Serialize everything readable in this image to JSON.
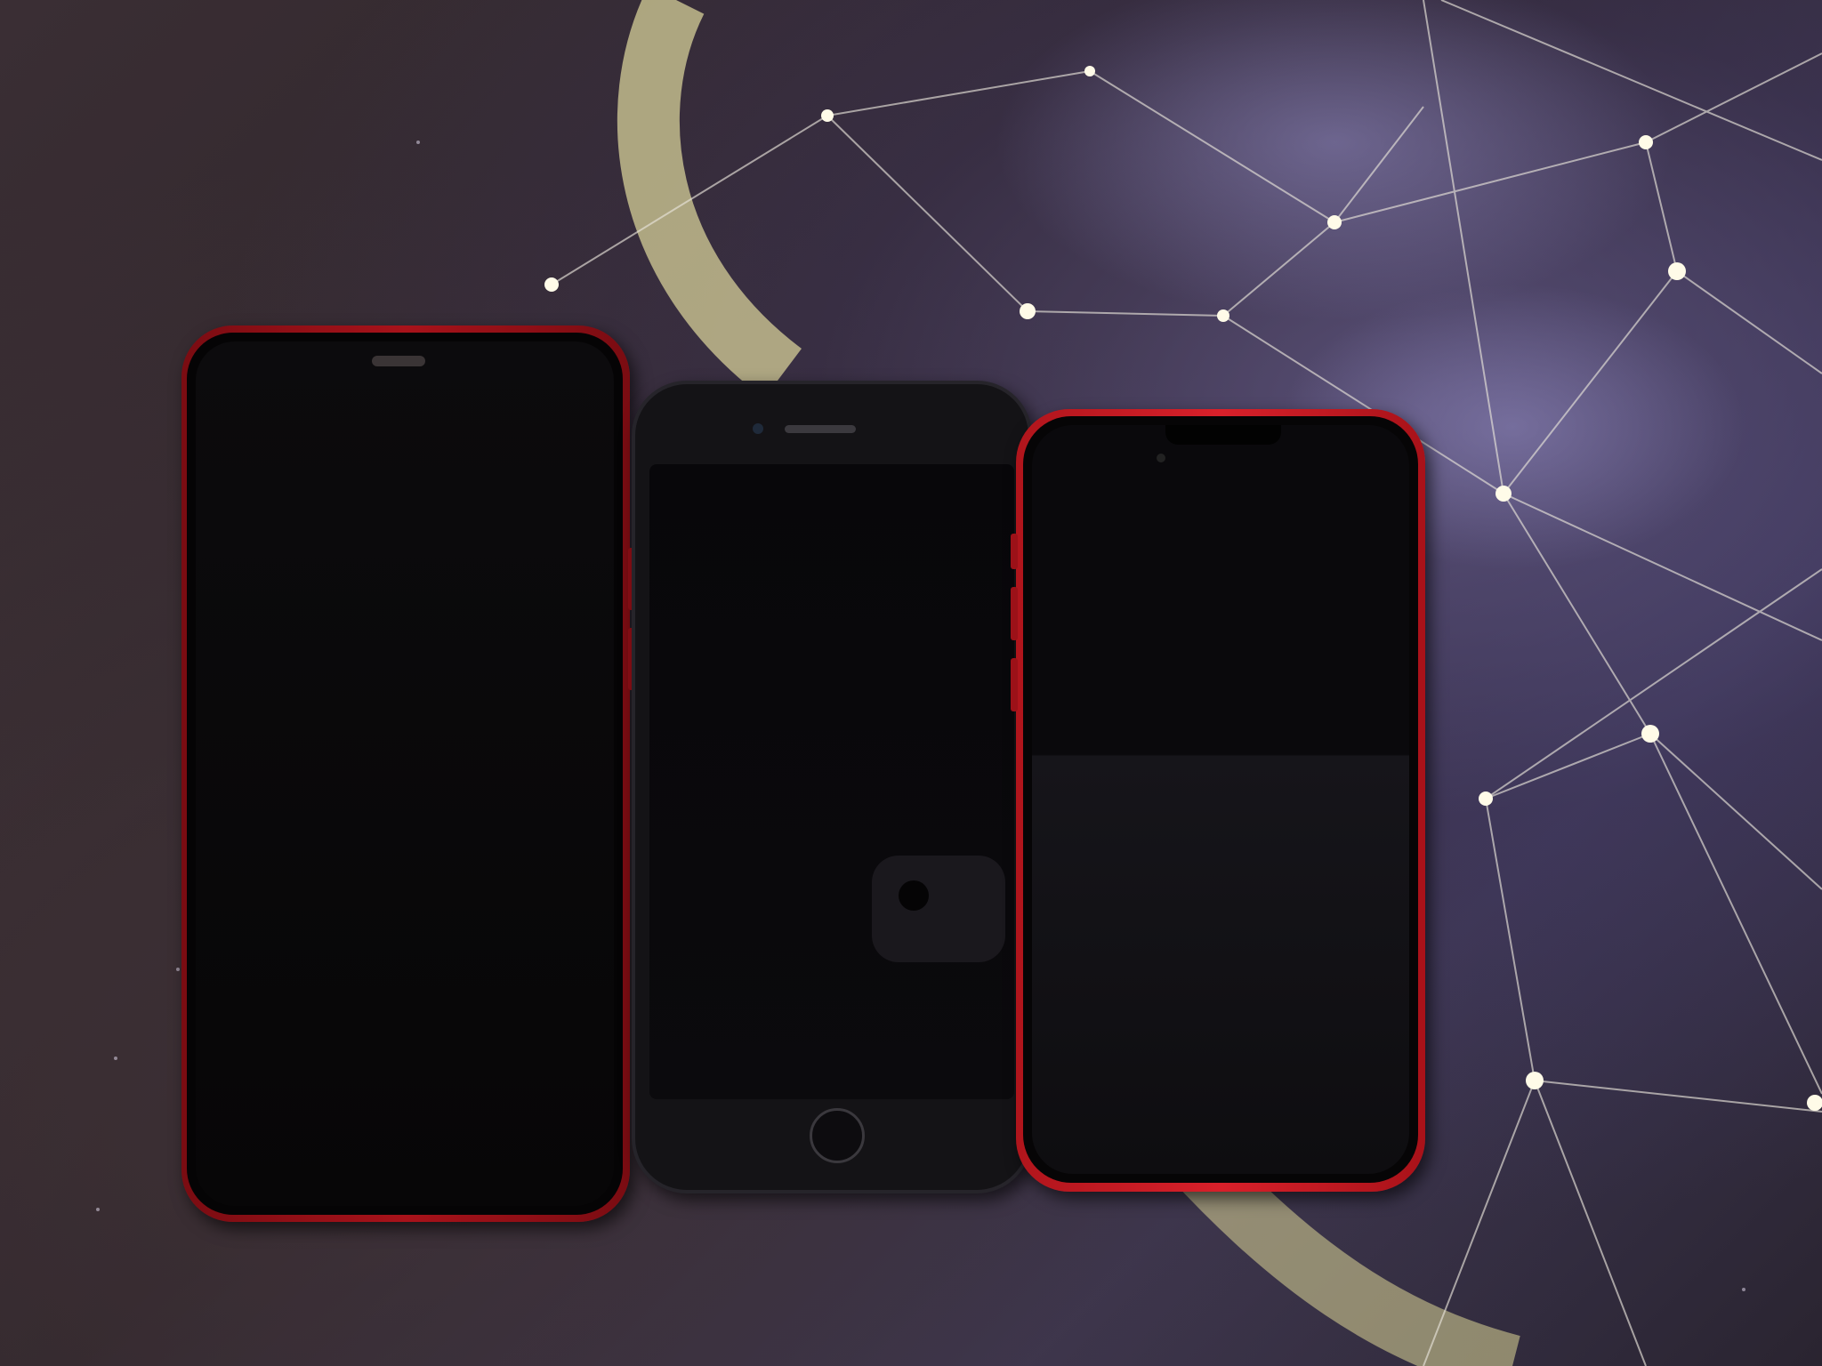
{
  "scene": {
    "description_colors": {
      "mat_dark": "#2d2429",
      "mat_purple": "#3b3550",
      "constellation_line": "#e8e4da",
      "moon_glow": "#d9d4a0"
    }
  },
  "phones": [
    {
      "name": "iphone-11-red",
      "body_color": "#a8121a",
      "screen": "off"
    },
    {
      "name": "iphone-se-black",
      "body_color": "#141316",
      "screen": "off"
    },
    {
      "name": "iphone-13-mini-red",
      "body_color": "#d8202a",
      "screen": "off"
    }
  ]
}
